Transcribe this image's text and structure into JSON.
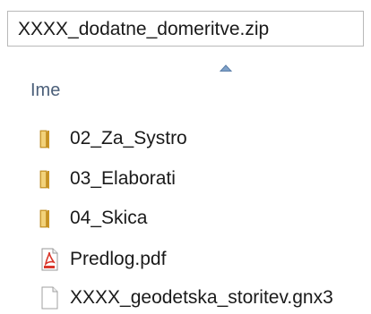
{
  "path_bar": {
    "text": "XXXX_dodatne_domeritve.zip"
  },
  "columns": {
    "name_header": "Ime",
    "sort_direction": "ascending"
  },
  "files": [
    {
      "label": "02_Za_Systro",
      "icon": "folder-icon"
    },
    {
      "label": "03_Elaborati",
      "icon": "folder-icon"
    },
    {
      "label": "04_Skica",
      "icon": "folder-icon"
    },
    {
      "label": "Predlog.pdf",
      "icon": "pdf-file-icon"
    },
    {
      "label": "XXXX_geodetska_storitev.gnx3",
      "icon": "generic-file-icon"
    }
  ],
  "colors": {
    "header_text": "#4c607a",
    "folder": "#e8c25a",
    "pdf_red": "#d9372b",
    "sort_arrow": "#5b7ea8"
  }
}
